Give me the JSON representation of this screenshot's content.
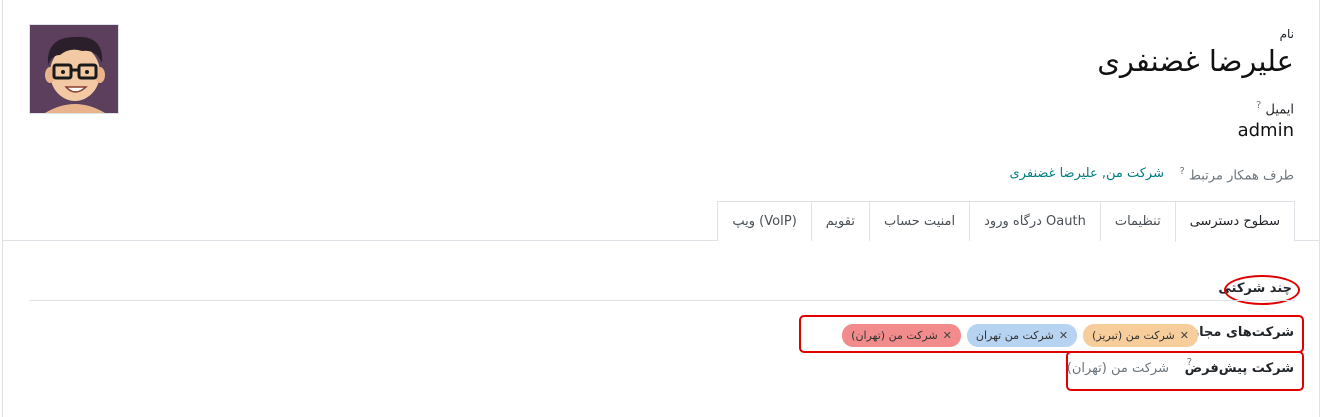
{
  "header": {
    "name_label": "نام",
    "full_name": "علیرضا غضنفری",
    "email_label": "ایمیل",
    "login": "admin",
    "help_mark": "?",
    "partner_label": "طرف همکار مرتبط",
    "partner_value": "شرکت من, علیرضا غضنفری"
  },
  "tabs": [
    {
      "label": "سطوح دسترسی",
      "active": true
    },
    {
      "label": "تنظیمات"
    },
    {
      "label": "درگاه ورود Oauth"
    },
    {
      "label": "امنیت حساب"
    },
    {
      "label": "تقویم"
    },
    {
      "label": "ویپ (VoIP)"
    }
  ],
  "multi_company": {
    "title": "چند شرکتی",
    "allowed_label": "شرکت‌های مجاز",
    "allowed_tags": [
      {
        "label": "شرکت من (تبریز)",
        "color": "#f6cd9b"
      },
      {
        "label": "شرکت من تهران",
        "color": "#b7d3f2"
      },
      {
        "label": "شرکت من (تهران)",
        "color": "#f28b8b"
      }
    ],
    "remove_glyph": "✕",
    "default_label": "شرکت پیش‌فرض",
    "default_value": "شرکت من (تهران)"
  },
  "colors": {
    "annotation": "#e00000",
    "link": "#017e84"
  }
}
